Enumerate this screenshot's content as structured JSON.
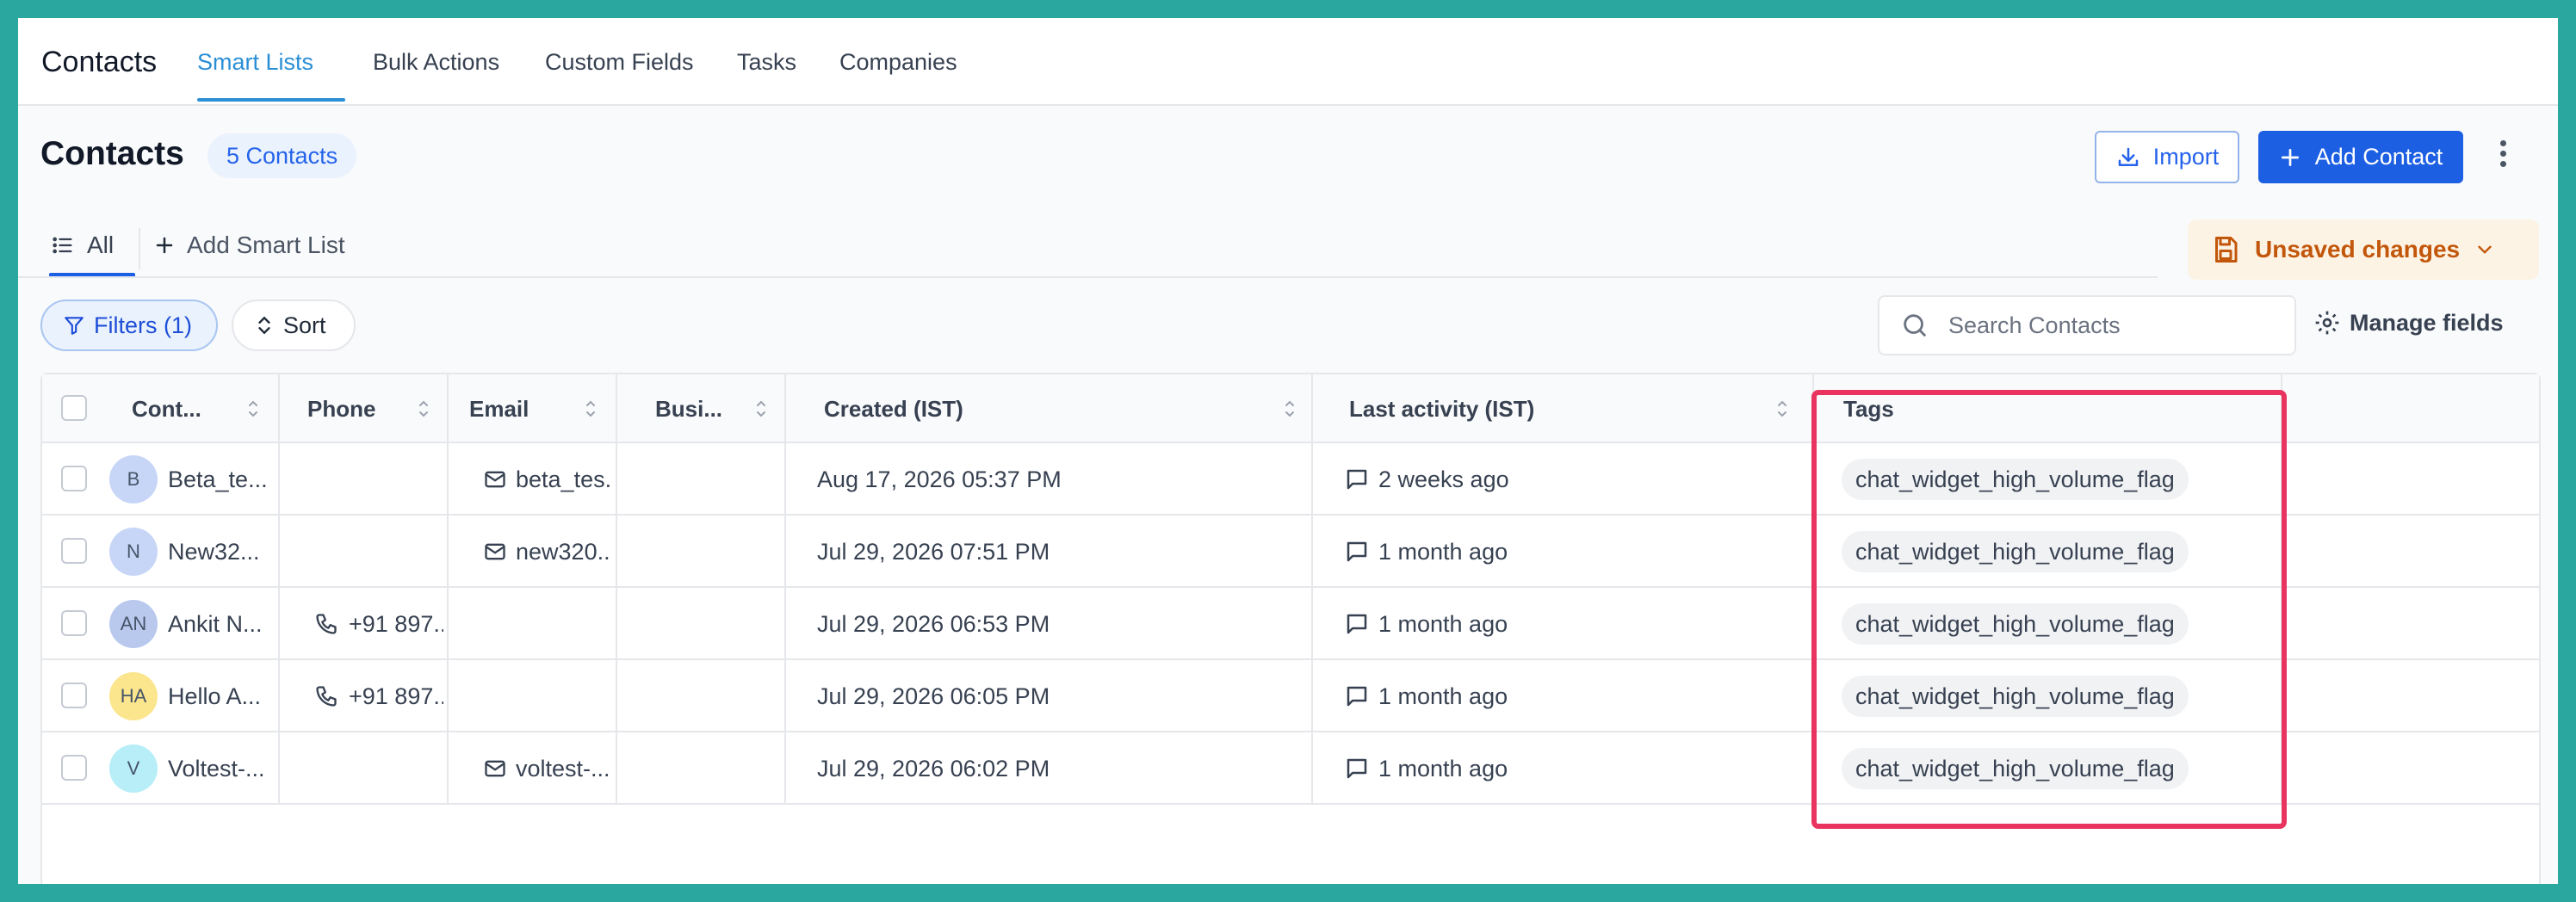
{
  "nav": {
    "title": "Contacts",
    "tabs": [
      {
        "label": "Smart Lists",
        "active": true
      },
      {
        "label": "Bulk Actions",
        "active": false
      },
      {
        "label": "Custom Fields",
        "active": false
      },
      {
        "label": "Tasks",
        "active": false
      },
      {
        "label": "Companies",
        "active": false
      }
    ]
  },
  "header": {
    "title": "Contacts",
    "count_badge": "5 Contacts",
    "import_label": "Import",
    "add_contact_label": "Add Contact"
  },
  "smart_lists": {
    "all_label": "All",
    "add_label": "Add Smart List",
    "unsaved_label": "Unsaved changes"
  },
  "toolbar": {
    "filters_label": "Filters (1)",
    "sort_label": "Sort",
    "search_placeholder": "Search Contacts",
    "manage_fields_label": "Manage fields"
  },
  "table": {
    "columns": [
      "Cont...",
      "Phone",
      "Email",
      "Busi...",
      "Created (IST)",
      "Last activity (IST)",
      "Tags"
    ],
    "rows": [
      {
        "initials": "B",
        "avatar_color": "#c7d6f7",
        "name": "Beta_te...",
        "phone": "",
        "email": "beta_tes...",
        "business": "",
        "created": "Aug 17, 2026 05:37 PM",
        "last_activity": "2 weeks ago",
        "tag": "chat_widget_high_volume_flag"
      },
      {
        "initials": "N",
        "avatar_color": "#c7d6f7",
        "name": "New32...",
        "phone": "",
        "email": "new320...",
        "business": "",
        "created": "Jul 29, 2026 07:51 PM",
        "last_activity": "1 month ago",
        "tag": "chat_widget_high_volume_flag"
      },
      {
        "initials": "AN",
        "avatar_color": "#b9c9ee",
        "name": "Ankit N...",
        "phone": "+91 897...",
        "email": "",
        "business": "",
        "created": "Jul 29, 2026 06:53 PM",
        "last_activity": "1 month ago",
        "tag": "chat_widget_high_volume_flag"
      },
      {
        "initials": "HA",
        "avatar_color": "#fbe58d",
        "name": "Hello A...",
        "phone": "+91 897...",
        "email": "",
        "business": "",
        "created": "Jul 29, 2026 06:05 PM",
        "last_activity": "1 month ago",
        "tag": "chat_widget_high_volume_flag"
      },
      {
        "initials": "V",
        "avatar_color": "#b7eef8",
        "name": "Voltest-...",
        "phone": "",
        "email": "voltest-...",
        "business": "",
        "created": "Jul 29, 2026 06:02 PM",
        "last_activity": "1 month ago",
        "tag": "chat_widget_high_volume_flag"
      }
    ]
  },
  "colors": {
    "frame_border": "#2aa8a0",
    "primary": "#1d5fe3",
    "active_tab": "#2b8fd6",
    "unsaved": "#c2570c",
    "highlight": "#e8345f"
  }
}
